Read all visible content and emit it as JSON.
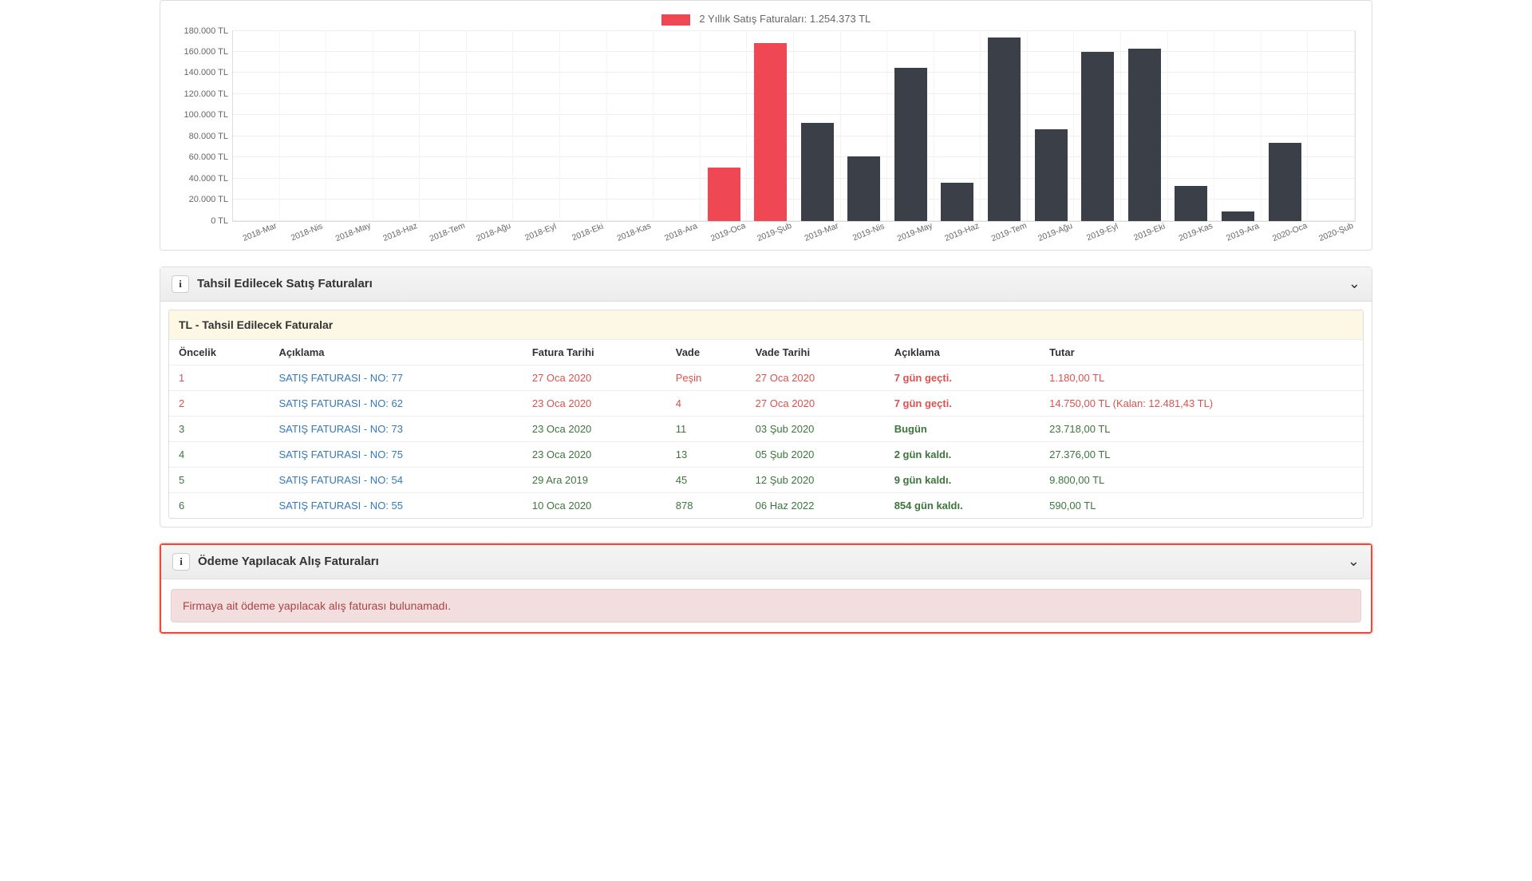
{
  "chart_data": {
    "type": "bar",
    "legend_label": "2 Yıllık Satış Faturaları: 1.254.373 TL",
    "ylabel_suffix": " TL",
    "ylim": [
      0,
      180000
    ],
    "ytick_step": 20000,
    "yticks": [
      "0 TL",
      "20.000 TL",
      "40.000 TL",
      "60.000 TL",
      "80.000 TL",
      "100.000 TL",
      "120.000 TL",
      "140.000 TL",
      "160.000 TL",
      "180.000 TL"
    ],
    "categories": [
      "2018-Mar",
      "2018-Nis",
      "2018-May",
      "2018-Haz",
      "2018-Tem",
      "2018-Ağu",
      "2018-Eyl",
      "2018-Eki",
      "2018-Kas",
      "2018-Ara",
      "2019-Oca",
      "2019-Şub",
      "2019-Mar",
      "2019-Nis",
      "2019-May",
      "2019-Haz",
      "2019-Tem",
      "2019-Ağu",
      "2019-Eyl",
      "2019-Eki",
      "2019-Kas",
      "2019-Ara",
      "2020-Oca",
      "2020-Şub"
    ],
    "series": [
      {
        "name": "highlight",
        "color": "red",
        "values": [
          0,
          0,
          0,
          0,
          0,
          0,
          0,
          0,
          0,
          0,
          50000,
          168000,
          0,
          0,
          0,
          0,
          0,
          0,
          0,
          0,
          0,
          0,
          0,
          0
        ]
      },
      {
        "name": "normal",
        "color": "dark",
        "values": [
          0,
          0,
          0,
          0,
          0,
          0,
          0,
          0,
          0,
          0,
          0,
          0,
          93000,
          61000,
          145000,
          36000,
          174000,
          87000,
          160000,
          163000,
          33000,
          9000,
          74000,
          0
        ]
      }
    ]
  },
  "receivables_panel": {
    "title": "Tahsil Edilecek Satış Faturaları",
    "subtitle": "TL - Tahsil Edilecek Faturalar",
    "columns": [
      "Öncelik",
      "Açıklama",
      "Fatura Tarihi",
      "Vade",
      "Vade Tarihi",
      "Açıklama",
      "Tutar"
    ],
    "rows": [
      {
        "priority": "1",
        "link": "SATIŞ FATURASI - NO: 77",
        "date": "27 Oca 2020",
        "vade": "Peşin",
        "vade_tarihi": "27 Oca 2020",
        "desc": "7 gün geçti.",
        "tutar": "1.180,00 TL",
        "tone": "red"
      },
      {
        "priority": "2",
        "link": "SATIŞ FATURASI - NO: 62",
        "date": "23 Oca 2020",
        "vade": "4",
        "vade_tarihi": "27 Oca 2020",
        "desc": "7 gün geçti.",
        "tutar": "14.750,00 TL (Kalan: 12.481,43 TL)",
        "tone": "red"
      },
      {
        "priority": "3",
        "link": "SATIŞ FATURASI - NO: 73",
        "date": "23 Oca 2020",
        "vade": "11",
        "vade_tarihi": "03 Şub 2020",
        "desc": "Bugün",
        "tutar": "23.718,00 TL",
        "tone": "green"
      },
      {
        "priority": "4",
        "link": "SATIŞ FATURASI - NO: 75",
        "date": "23 Oca 2020",
        "vade": "13",
        "vade_tarihi": "05 Şub 2020",
        "desc": "2 gün kaldı.",
        "tutar": "27.376,00 TL",
        "tone": "green"
      },
      {
        "priority": "5",
        "link": "SATIŞ FATURASI - NO: 54",
        "date": "29 Ara 2019",
        "vade": "45",
        "vade_tarihi": "12 Şub 2020",
        "desc": "9 gün kaldı.",
        "tutar": "9.800,00 TL",
        "tone": "green"
      },
      {
        "priority": "6",
        "link": "SATIŞ FATURASI - NO: 55",
        "date": "10 Oca 2020",
        "vade": "878",
        "vade_tarihi": "06 Haz 2022",
        "desc": "854 gün kaldı.",
        "tutar": "590,00 TL",
        "tone": "green"
      }
    ]
  },
  "payables_panel": {
    "title": "Ödeme Yapılacak Alış Faturaları",
    "empty_message": "Firmaya ait ödeme yapılacak alış faturası bulunamadı."
  }
}
